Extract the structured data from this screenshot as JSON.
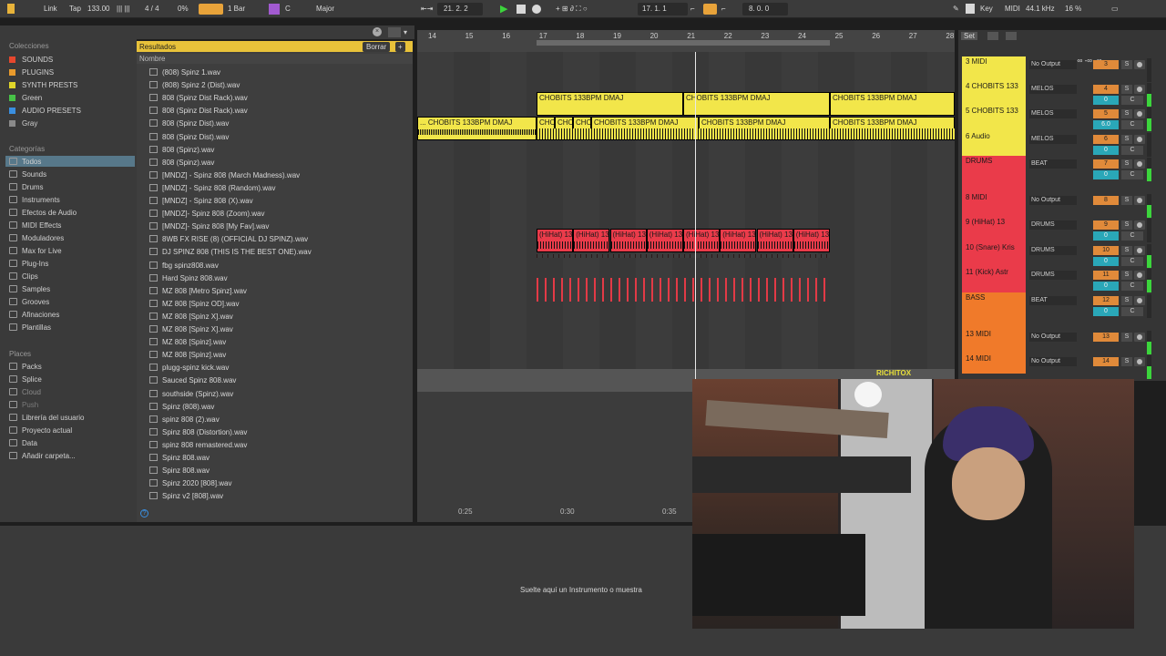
{
  "transport": {
    "link": "Link",
    "tap": "Tap",
    "tempo": "133.00",
    "meter": "4 / 4",
    "percent": "0%",
    "quant": "1 Bar",
    "key": "C",
    "scale": "Major",
    "position": "21.  2.  2",
    "loop_start": "17.  1.  1",
    "loop_len": "8.  0.  0",
    "key_label": "Key",
    "midi_label": "MIDI",
    "sample_rate": "44.1 kHz",
    "cpu": "16 %"
  },
  "search": {
    "value": "spinz"
  },
  "collections": {
    "title": "Colecciones",
    "items": [
      {
        "label": "SOUNDS",
        "color": "#e6472e"
      },
      {
        "label": "PLUGINS",
        "color": "#e89a2c"
      },
      {
        "label": "SYNTH PRESTS",
        "color": "#e0d62a"
      },
      {
        "label": "Green",
        "color": "#47c247"
      },
      {
        "label": "AUDIO PRESETS",
        "color": "#3a8fe0"
      },
      {
        "label": "Gray",
        "color": "#8a8a8a"
      }
    ]
  },
  "categories": {
    "title": "Categorías",
    "items": [
      "Todos",
      "Sounds",
      "Drums",
      "Instruments",
      "Efectos de Audio",
      "MIDI Effects",
      "Moduladores",
      "Max for Live",
      "Plug-Ins",
      "Clips",
      "Samples",
      "Grooves",
      "Afinaciones",
      "Plantillas"
    ]
  },
  "places": {
    "title": "Places",
    "items": [
      "Packs",
      "Splice",
      "Cloud",
      "Push",
      "Librería del usuario",
      "Proyecto actual",
      "Data",
      "Añadir carpeta..."
    ]
  },
  "results": {
    "header": "Resultados",
    "clear_label": "Borrar",
    "column": "Nombre",
    "files": [
      "(808) Spinz 1.wav",
      "(808) Spinz 2 (Dist).wav",
      "808 (Spinz Dist Rack).wav",
      "808 (Spinz Dist Rack).wav",
      "808 (Spinz Dist).wav",
      "808 (Spinz Dist).wav",
      "808 (Spinz).wav",
      "808 (Spinz).wav",
      "[MNDZ] - Spinz 808 (March Madness).wav",
      "[MNDZ] - Spinz 808 (Random).wav",
      "[MNDZ] - Spinz 808 (X).wav",
      "[MNDZ]- Spinz 808 (Zoom).wav",
      "[MNDZ]- Spinz 808 [My Fav].wav",
      "8WB FX RISE (8) (OFFICIAL DJ SPINZ).wav",
      "DJ SPINZ 808 (THIS IS THE BEST ONE).wav",
      "fbg spinz808.wav",
      "Hard Spinz 808.wav",
      "MZ 808 [Metro Spinz].wav",
      "MZ 808 [Spinz OD].wav",
      "MZ 808 [Spinz X].wav",
      "MZ 808 [Spinz X].wav",
      "MZ 808 [Spinz].wav",
      "MZ 808 [Spinz].wav",
      "plugg-spinz kick.wav",
      "Sauced Spinz 808.wav",
      "southside (Spinz).wav",
      "Spinz (808).wav",
      "spinz 808 (2).wav",
      "Spinz 808 (Distortion).wav",
      "spinz 808 remastered.wav",
      "Spinz 808.wav",
      "Spinz 808.wav",
      "Spinz 2020 [808].wav",
      "Spinz v2 [808].wav"
    ]
  },
  "ruler": {
    "bars": [
      "14",
      "15",
      "16",
      "17",
      "18",
      "19",
      "20",
      "21",
      "22",
      "23",
      "24",
      "25",
      "26",
      "27",
      "28"
    ],
    "times": [
      "0:25",
      "0:30",
      "0:35"
    ]
  },
  "clips": {
    "chobits": "CHOBITS 133BPM DMAJ",
    "chobits_lead": "... CHOBITS 133BPM DMAJ",
    "choi": "CHOI",
    "hihat": "(HiHat) 13"
  },
  "set_label": "Set",
  "tracks": [
    {
      "name": "3 MIDI",
      "color": "#f2e64a",
      "route": "No Output",
      "num": "3",
      "vol": ""
    },
    {
      "name": "4 CHOBITS 133",
      "color": "#f2e64a",
      "route": "MELOS",
      "num": "4",
      "vol": "0"
    },
    {
      "name": "5 CHOBITS 133",
      "color": "#f2e64a",
      "route": "MELOS",
      "num": "5",
      "vol": "6.0"
    },
    {
      "name": "6 Audio",
      "color": "#f2e64a",
      "route": "MELOS",
      "num": "6",
      "vol": "0"
    },
    {
      "name": "DRUMS",
      "color": "#ea3b4a",
      "route": "BEAT",
      "num": "7",
      "vol": "0"
    },
    {
      "name": "8 MIDI",
      "color": "#ea3b4a",
      "route": "No Output",
      "num": "8",
      "vol": ""
    },
    {
      "name": "9 (HiHat) 13",
      "color": "#ea3b4a",
      "route": "DRUMS",
      "num": "9",
      "vol": "0"
    },
    {
      "name": "10 (Snare) Kris",
      "color": "#ea3b4a",
      "route": "DRUMS",
      "num": "10",
      "vol": "0"
    },
    {
      "name": "11 (Kick) Astr",
      "color": "#ea3b4a",
      "route": "DRUMS",
      "num": "11",
      "vol": "0"
    },
    {
      "name": "BASS",
      "color": "#f07a2a",
      "route": "BEAT",
      "num": "12",
      "vol": "0"
    },
    {
      "name": "13 MIDI",
      "color": "#f07a2a",
      "route": "No Output",
      "num": "13",
      "vol": ""
    },
    {
      "name": "14 MIDI",
      "color": "#f07a2a",
      "route": "No Output",
      "num": "14",
      "vol": ""
    }
  ],
  "mixer_top": [
    "-∞",
    "-∞",
    "-∞"
  ],
  "dropzone": "Suelte aquí un Instrumento o muestra",
  "webcam": {
    "tag": "RICHITOX"
  },
  "colors": {
    "yellow": "#f2e64a",
    "red": "#ea3b4a",
    "orange": "#f07a2a",
    "accent": "#e8a33a"
  }
}
